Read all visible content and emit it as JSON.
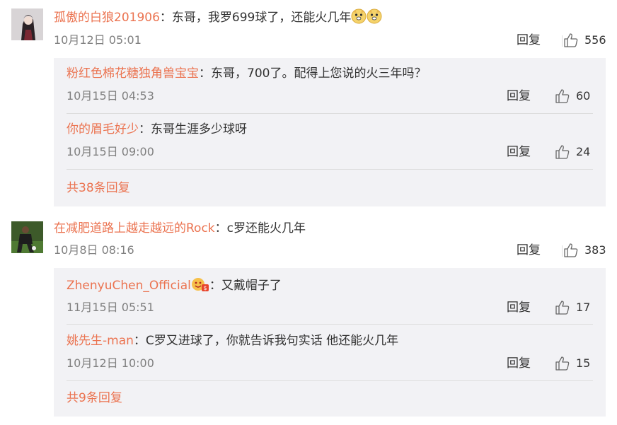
{
  "comments": [
    {
      "username": "孤傲的白狼201906",
      "separator": "：",
      "text": "东哥，我罗699球了，还能火几年",
      "emojis": [
        "doge-emoji",
        "doge-emoji"
      ],
      "time": "10月12日 05:01",
      "reply_label": "回复",
      "likes": "556",
      "replies": [
        {
          "username": "粉红色棉花糖独角兽宝宝",
          "separator": "：",
          "text": "东哥，700了。配得上您说的火三年吗？",
          "time": "10月15日 04:53",
          "reply_label": "回复",
          "likes": "60"
        },
        {
          "username": "你的眉毛好少",
          "separator": "：",
          "text": "东哥生涯多少球呀",
          "time": "10月15日 09:00",
          "reply_label": "回复",
          "likes": "24"
        }
      ],
      "more_replies": "共38条回复"
    },
    {
      "username": "在减肥道路上越走越远的Rock",
      "separator": "：",
      "text": "c罗还能火几年",
      "time": "10月8日 08:16",
      "reply_label": "回复",
      "likes": "383",
      "replies": [
        {
          "username": "ZhenyuChen_Official",
          "badge": "vip-badge-icon",
          "separator": "：",
          "text": "又戴帽子了",
          "time": "11月15日 05:51",
          "reply_label": "回复",
          "likes": "17"
        },
        {
          "username": "姚先生-man",
          "separator": "：",
          "text": "C罗又进球了，你就告诉我句实话 他还能火几年",
          "time": "10月12日 10:00",
          "reply_label": "回复",
          "likes": "15"
        }
      ],
      "more_replies": "共9条回复"
    }
  ],
  "colors": {
    "username": "#eb7350",
    "text": "#333333",
    "meta": "#808080",
    "reply_bg": "#f2f2f5"
  }
}
